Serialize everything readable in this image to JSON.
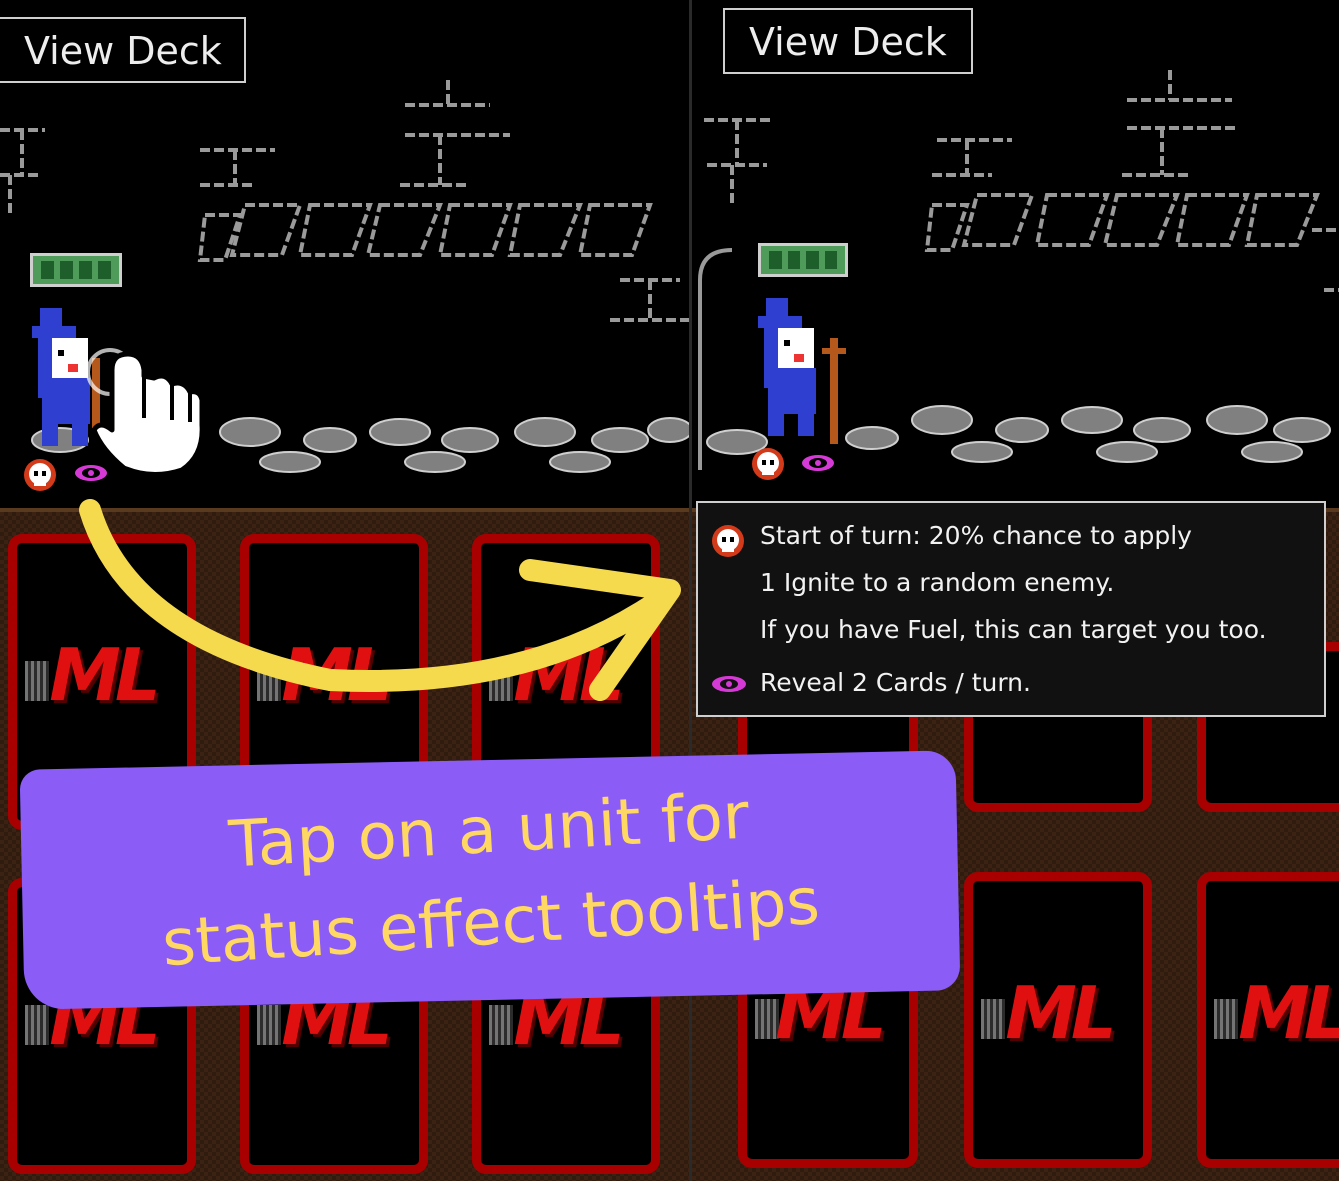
{
  "left_panel": {
    "view_deck_label": "View Deck",
    "unit": {
      "name": "wizard",
      "health_segments": 4
    },
    "status_icons": [
      "skull-flame-icon",
      "eye-icon"
    ],
    "cards": [
      {
        "logo": "ML"
      },
      {
        "logo": "ML"
      },
      {
        "logo": "ML"
      },
      {
        "logo": "ML"
      },
      {
        "logo": "ML"
      },
      {
        "logo": "ML"
      }
    ]
  },
  "right_panel": {
    "view_deck_label": "View Deck",
    "unit": {
      "name": "wizard",
      "health_segments": 4
    },
    "status_icons": [
      "skull-flame-icon",
      "eye-icon"
    ],
    "tooltip": {
      "lines": [
        "Start of turn: 20% chance to apply",
        "1 Ignite to a random enemy.",
        "If you have Fuel, this can target you too.",
        "Reveal 2 Cards / turn."
      ]
    },
    "cards": [
      {
        "logo": "ML"
      },
      {
        "logo": "ML"
      },
      {
        "logo": "ML"
      }
    ]
  },
  "annotation": {
    "line1": "Tap on a unit for",
    "line2": "status effect tooltips"
  },
  "colors": {
    "card_border": "#a80000",
    "logo": "#e01010",
    "banner": "#8b5cf6",
    "banner_text": "#ffd863",
    "arrow": "#f6da4e",
    "health": "#4e9b5a",
    "eye": "#d63ad6"
  }
}
